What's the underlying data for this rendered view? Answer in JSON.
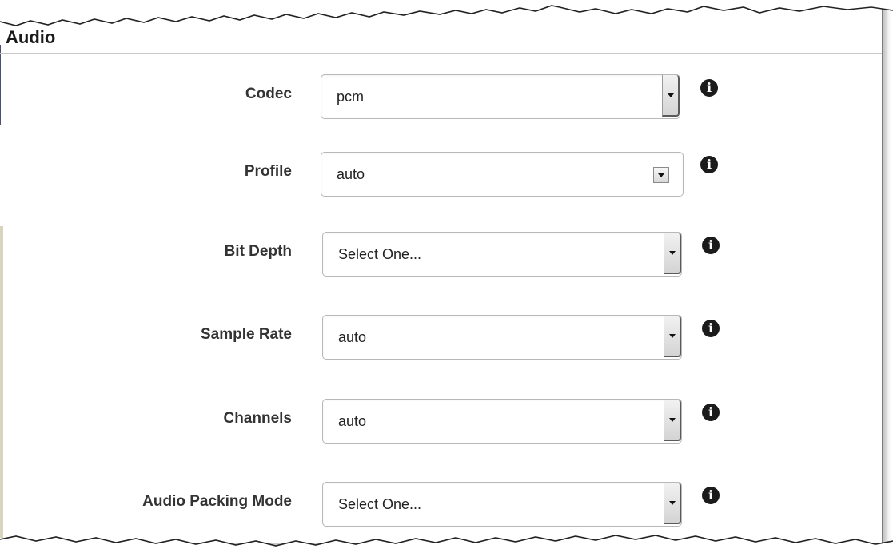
{
  "section": {
    "title": "Audio"
  },
  "fields": [
    {
      "label": "Codec",
      "value": "pcm",
      "control": "dropdown",
      "icon": "info-icon"
    },
    {
      "label": "Profile",
      "value": "auto",
      "control": "dropdown",
      "icon": "info-icon"
    },
    {
      "label": "Bit Depth",
      "value": "Select One...",
      "control": "dropdown",
      "icon": "info-icon"
    },
    {
      "label": "Sample Rate",
      "value": "auto",
      "control": "dropdown",
      "icon": "info-icon"
    },
    {
      "label": "Channels",
      "value": "auto",
      "control": "dropdown",
      "icon": "info-icon"
    },
    {
      "label": "Audio Packing Mode",
      "value": "Select One...",
      "control": "dropdown",
      "icon": "info-icon"
    }
  ],
  "icons": {
    "info": "info-icon",
    "dropdown_arrow": "chevron-down-icon"
  },
  "colors": {
    "label_text": "#333333",
    "info_icon": "#1b1b1b",
    "field_border": "#b8b8b8"
  }
}
